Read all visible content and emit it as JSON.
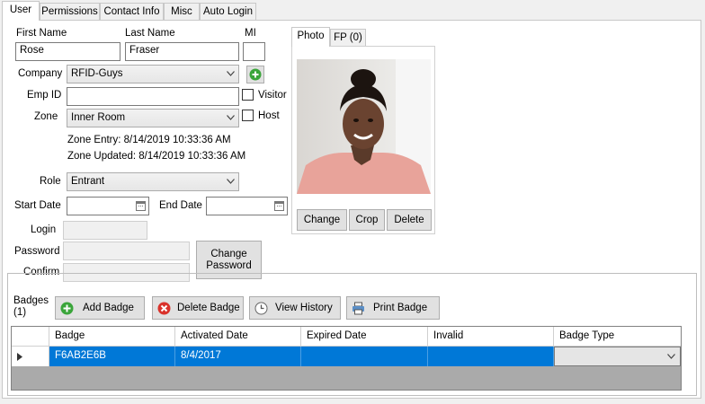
{
  "tabs": [
    "User",
    "Permissions",
    "Contact Info",
    "Misc",
    "Auto Login"
  ],
  "name": {
    "first_label": "First Name",
    "first_value": "Rose",
    "last_label": "Last Name",
    "last_value": "Fraser",
    "mi_label": "MI",
    "mi_value": ""
  },
  "company": {
    "label": "Company",
    "value": "RFID-Guys"
  },
  "emp_id": {
    "label": "Emp ID",
    "value": ""
  },
  "visitor": {
    "label": "Visitor",
    "checked": false
  },
  "zone": {
    "label": "Zone",
    "value": "Inner Room"
  },
  "host": {
    "label": "Host",
    "checked": false
  },
  "zone_entry": "Zone Entry: 8/14/2019 10:33:36 AM",
  "zone_updated": "Zone Updated: 8/14/2019 10:33:36 AM",
  "role": {
    "label": "Role",
    "value": "Entrant"
  },
  "start_date": {
    "label": "Start Date",
    "value": ""
  },
  "end_date": {
    "label": "End Date",
    "value": ""
  },
  "login": {
    "label": "Login",
    "value": ""
  },
  "password": {
    "label": "Password",
    "value": ""
  },
  "confirm": {
    "label": "Confirm",
    "value": ""
  },
  "change_password_label": "Change\nPassword",
  "photo_tabs": [
    "Photo",
    "FP (0)"
  ],
  "photo_buttons": {
    "change": "Change",
    "crop": "Crop",
    "delete": "Delete"
  },
  "badges": {
    "title": "Badges\n(1)",
    "buttons": {
      "add": "Add Badge",
      "delete": "Delete Badge",
      "history": "View History",
      "print": "Print Badge"
    },
    "columns": [
      "Badge",
      "Activated Date",
      "Expired Date",
      "Invalid",
      "Badge Type"
    ],
    "rows": [
      {
        "badge": "F6AB2E6B",
        "activated": "8/4/2017",
        "expired": "",
        "invalid": "",
        "type": ""
      }
    ]
  },
  "colors": {
    "selection": "#0078d7",
    "add_icon": "#3aa53a",
    "delete_icon": "#d9322b"
  },
  "icons": {
    "add_company": "plus-circle-icon",
    "add_badge": "plus-circle-icon",
    "delete_badge": "x-circle-icon",
    "view_history": "clock-icon",
    "print_badge": "printer-icon"
  }
}
